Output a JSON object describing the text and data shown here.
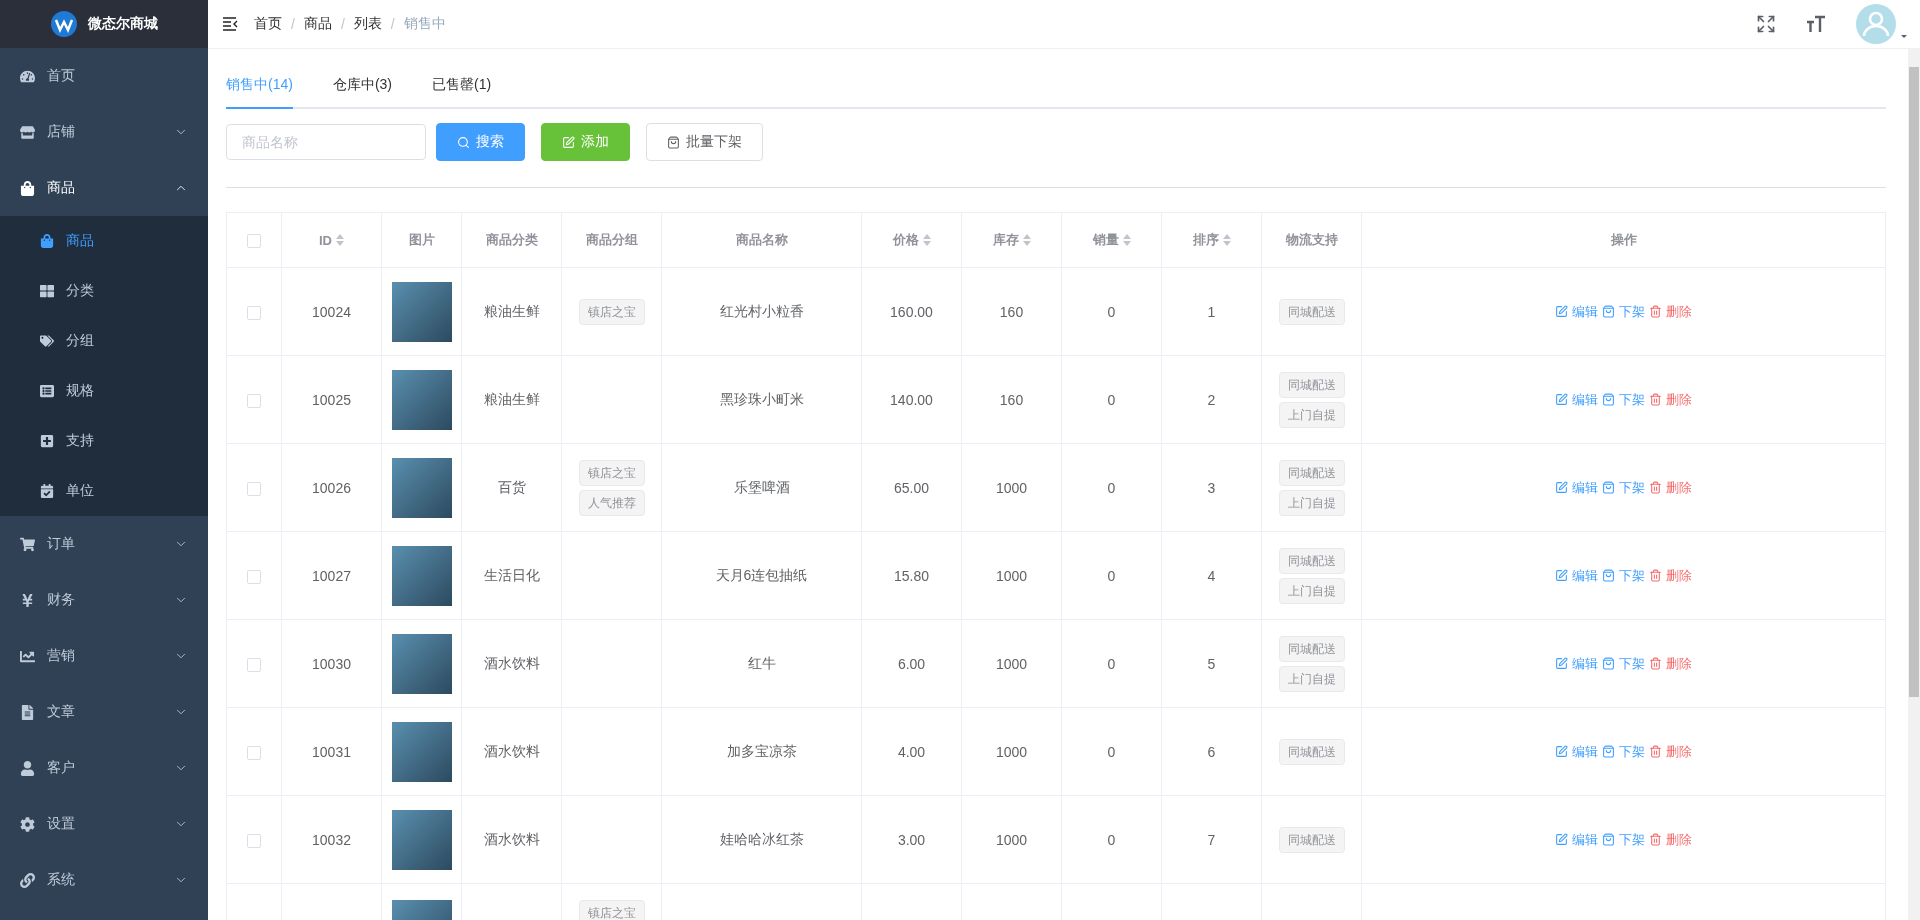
{
  "brand": {
    "name": "微态尔商城"
  },
  "sidebar": {
    "items": [
      {
        "label": "首页",
        "selected": false
      },
      {
        "label": "店铺",
        "expanded": false
      },
      {
        "label": "商品",
        "expanded": true,
        "children": [
          {
            "label": "商品",
            "selected": true
          },
          {
            "label": "分类",
            "selected": false
          },
          {
            "label": "分组",
            "selected": false
          },
          {
            "label": "规格",
            "selected": false
          },
          {
            "label": "支持",
            "selected": false
          },
          {
            "label": "单位",
            "selected": false
          }
        ]
      },
      {
        "label": "订单",
        "expanded": false
      },
      {
        "label": "财务",
        "expanded": false
      },
      {
        "label": "营销",
        "expanded": false
      },
      {
        "label": "文章",
        "expanded": false
      },
      {
        "label": "客户",
        "expanded": false
      },
      {
        "label": "设置",
        "expanded": false
      },
      {
        "label": "系统",
        "expanded": false
      }
    ]
  },
  "breadcrumb": [
    {
      "label": "首页"
    },
    {
      "separator": "/",
      "label": "商品"
    },
    {
      "separator": "/",
      "label": "列表"
    },
    {
      "separator": "/",
      "label": "销售中"
    }
  ],
  "tabs": [
    {
      "label": "销售中(14)",
      "selected": true
    },
    {
      "label": "仓库中(3)",
      "selected": false
    },
    {
      "label": "已售罄(1)",
      "selected": false
    }
  ],
  "search": {
    "placeholder": "商品名称"
  },
  "buttons": [
    {
      "label": "搜索",
      "kind": "search"
    },
    {
      "label": "添加",
      "kind": "add"
    },
    {
      "label": "批量下架",
      "kind": "unlist"
    }
  ],
  "table": {
    "all_checked": false,
    "columns": [
      {
        "label": "ID",
        "sortable": true
      },
      {
        "label": "图片",
        "sortable": false
      },
      {
        "label": "商品分类",
        "sortable": false
      },
      {
        "label": "商品分组",
        "sortable": false
      },
      {
        "label": "商品名称",
        "sortable": false
      },
      {
        "label": "价格",
        "sortable": true
      },
      {
        "label": "库存",
        "sortable": true
      },
      {
        "label": "销量",
        "sortable": true
      },
      {
        "label": "排序",
        "sortable": true
      },
      {
        "label": "物流支持",
        "sortable": false
      },
      {
        "label": "操作",
        "sortable": false
      }
    ],
    "rows": [
      {
        "checked": false,
        "id": "10024",
        "category": "粮油生鲜",
        "groups": [
          "镇店之宝"
        ],
        "name": "红光村小粒香",
        "price": "160.00",
        "stock": "160",
        "sales": "0",
        "sort": "1",
        "logistics": [
          "同城配送"
        ],
        "actions": [
          {
            "label": "编辑",
            "kind": "edit"
          },
          {
            "label": "下架",
            "kind": "unlist"
          },
          {
            "label": "删除",
            "kind": "delete"
          }
        ]
      },
      {
        "checked": false,
        "id": "10025",
        "category": "粮油生鲜",
        "groups": [],
        "name": "黑珍珠小町米",
        "price": "140.00",
        "stock": "160",
        "sales": "0",
        "sort": "2",
        "logistics": [
          "同城配送",
          "上门自提"
        ],
        "actions": [
          {
            "label": "编辑",
            "kind": "edit"
          },
          {
            "label": "下架",
            "kind": "unlist"
          },
          {
            "label": "删除",
            "kind": "delete"
          }
        ]
      },
      {
        "checked": false,
        "id": "10026",
        "category": "百货",
        "groups": [
          "镇店之宝",
          "人气推荐"
        ],
        "name": "乐堡啤酒",
        "price": "65.00",
        "stock": "1000",
        "sales": "0",
        "sort": "3",
        "logistics": [
          "同城配送",
          "上门自提"
        ],
        "actions": [
          {
            "label": "编辑",
            "kind": "edit"
          },
          {
            "label": "下架",
            "kind": "unlist"
          },
          {
            "label": "删除",
            "kind": "delete"
          }
        ]
      },
      {
        "checked": false,
        "id": "10027",
        "category": "生活日化",
        "groups": [],
        "name": "天月6连包抽纸",
        "price": "15.80",
        "stock": "1000",
        "sales": "0",
        "sort": "4",
        "logistics": [
          "同城配送",
          "上门自提"
        ],
        "actions": [
          {
            "label": "编辑",
            "kind": "edit"
          },
          {
            "label": "下架",
            "kind": "unlist"
          },
          {
            "label": "删除",
            "kind": "delete"
          }
        ]
      },
      {
        "checked": false,
        "id": "10030",
        "category": "酒水饮料",
        "groups": [],
        "name": "红牛",
        "price": "6.00",
        "stock": "1000",
        "sales": "0",
        "sort": "5",
        "logistics": [
          "同城配送",
          "上门自提"
        ],
        "actions": [
          {
            "label": "编辑",
            "kind": "edit"
          },
          {
            "label": "下架",
            "kind": "unlist"
          },
          {
            "label": "删除",
            "kind": "delete"
          }
        ]
      },
      {
        "checked": false,
        "id": "10031",
        "category": "酒水饮料",
        "groups": [],
        "name": "加多宝凉茶",
        "price": "4.00",
        "stock": "1000",
        "sales": "0",
        "sort": "6",
        "logistics": [
          "同城配送"
        ],
        "actions": [
          {
            "label": "编辑",
            "kind": "edit"
          },
          {
            "label": "下架",
            "kind": "unlist"
          },
          {
            "label": "删除",
            "kind": "delete"
          }
        ]
      },
      {
        "checked": false,
        "id": "10032",
        "category": "酒水饮料",
        "groups": [],
        "name": "娃哈哈冰红茶",
        "price": "3.00",
        "stock": "1000",
        "sales": "0",
        "sort": "7",
        "logistics": [
          "同城配送"
        ],
        "actions": [
          {
            "label": "编辑",
            "kind": "edit"
          },
          {
            "label": "下架",
            "kind": "unlist"
          },
          {
            "label": "删除",
            "kind": "delete"
          }
        ]
      },
      {
        "groups": [
          "镇店之宝"
        ]
      }
    ]
  }
}
